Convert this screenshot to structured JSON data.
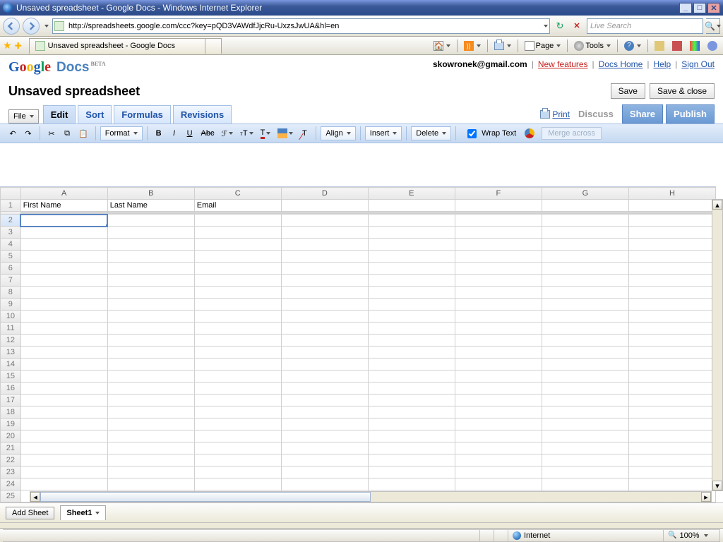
{
  "window": {
    "title": "Unsaved spreadsheet - Google Docs - Windows Internet Explorer"
  },
  "browser": {
    "url": "http://spreadsheets.google.com/ccc?key=pQD3VAWdfJjcRu-UxzsJwUA&hl=en",
    "tab_title": "Unsaved spreadsheet - Google Docs",
    "search_placeholder": "Live Search",
    "menu_page": "Page",
    "menu_tools": "Tools"
  },
  "header": {
    "brand": {
      "google": "Google",
      "docs": "Docs",
      "beta": "BETA"
    },
    "email": "skowronek@gmail.com",
    "links": {
      "new": "New features",
      "home": "Docs Home",
      "help": "Help",
      "signout": "Sign Out"
    }
  },
  "doc": {
    "title": "Unsaved spreadsheet",
    "save": "Save",
    "save_close": "Save & close",
    "file": "File"
  },
  "tabs": {
    "edit": "Edit",
    "sort": "Sort",
    "formulas": "Formulas",
    "revisions": "Revisions"
  },
  "right_actions": {
    "print": "Print",
    "discuss": "Discuss",
    "share": "Share",
    "publish": "Publish"
  },
  "fmt": {
    "format": "Format",
    "align": "Align",
    "insert": "Insert",
    "delete": "Delete",
    "wrap": "Wrap Text",
    "merge": "Merge across"
  },
  "grid": {
    "columns": [
      "A",
      "B",
      "C",
      "D",
      "E",
      "F",
      "G",
      "H"
    ],
    "rows_visible": [
      1,
      2,
      3,
      4,
      5,
      6,
      7,
      8,
      9,
      10,
      11,
      12,
      13,
      14,
      15,
      16,
      17,
      18,
      19,
      20,
      21,
      22,
      23,
      24,
      25
    ],
    "last_row_marker": "+",
    "selected_cell": "A2",
    "cells": {
      "A1": "First Name",
      "B1": "Last Name",
      "C1": "Email"
    }
  },
  "sheetbar": {
    "add": "Add Sheet",
    "sheet1": "Sheet1"
  },
  "status": {
    "zone": "Internet",
    "zoom": "100%"
  }
}
